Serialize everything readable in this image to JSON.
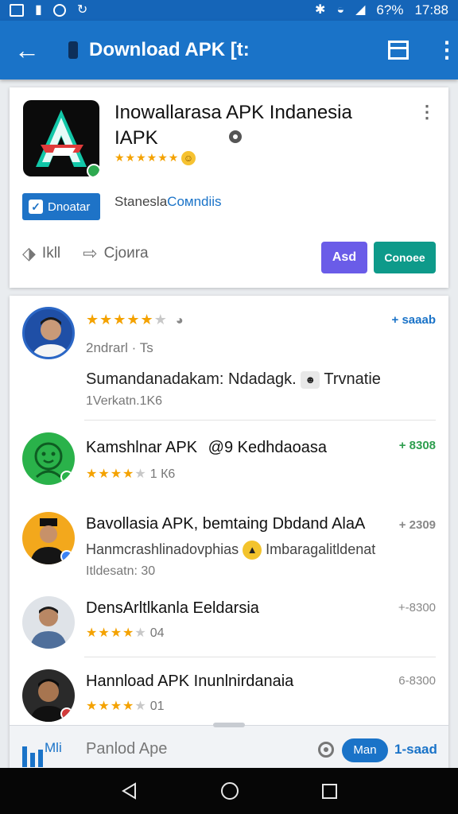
{
  "status_bar": {
    "battery": "6?%",
    "time": "17:88"
  },
  "app_bar": {
    "title": "Download APK [t:"
  },
  "app_card": {
    "name_line1": "Inowallarasa APK Indanesia",
    "name_line2": "IAPK",
    "stars": "★★★★★★",
    "verify_label": "Dnoatar",
    "publisher_prefix": "Staneslа",
    "publisher_link": "Coмndiis",
    "action1_label": "Ikll",
    "action2_label": "Cjoиra",
    "add_label": "Asd",
    "connect_label": "Conoee",
    "logo_letter": "A"
  },
  "list": [
    {
      "title_stars": "★★★★★",
      "meta": "2ndrarl · Ts",
      "line": "Sumandanadakam: Ndadagk.",
      "line_after": "Trvnatie",
      "sub": "1Verkatn.1K6",
      "action": "+ saaab",
      "action_color": "#1a73c8"
    },
    {
      "title": "Kamshlnar APK",
      "title_extra": "@9 Kedhdaoasa",
      "stars_count": "1 К6",
      "action": "+ 8308",
      "action_color": "#2e9e4f"
    },
    {
      "title": "Bavollasia APK, bemtaing Dbdand AlaA",
      "line": "Hanmcrashlinadovphias",
      "line_after": "Imbaragalitldenat",
      "sub": "Itldesatn: 30",
      "action": "+ 2309",
      "action_color": "#888888"
    },
    {
      "title": "DensArltlkanla Eeldarsia",
      "stars_count": "04",
      "action": "+-8300",
      "action_color": "#888888"
    },
    {
      "title": "Hannload APK Inunlnirdanaia",
      "stars_count": "01",
      "action": "6-8300",
      "action_color": "#888888"
    }
  ],
  "bottom_bar": {
    "icon_label": "Mli",
    "title": "Panlod Ape",
    "pill_label": "Man",
    "count": "1-saad"
  },
  "colors": {
    "primary": "#1a73c8",
    "status_bar": "#1565b8",
    "star": "#f4a200",
    "add_button": "#6a5ce8",
    "connect_button": "#0e9a8a"
  }
}
